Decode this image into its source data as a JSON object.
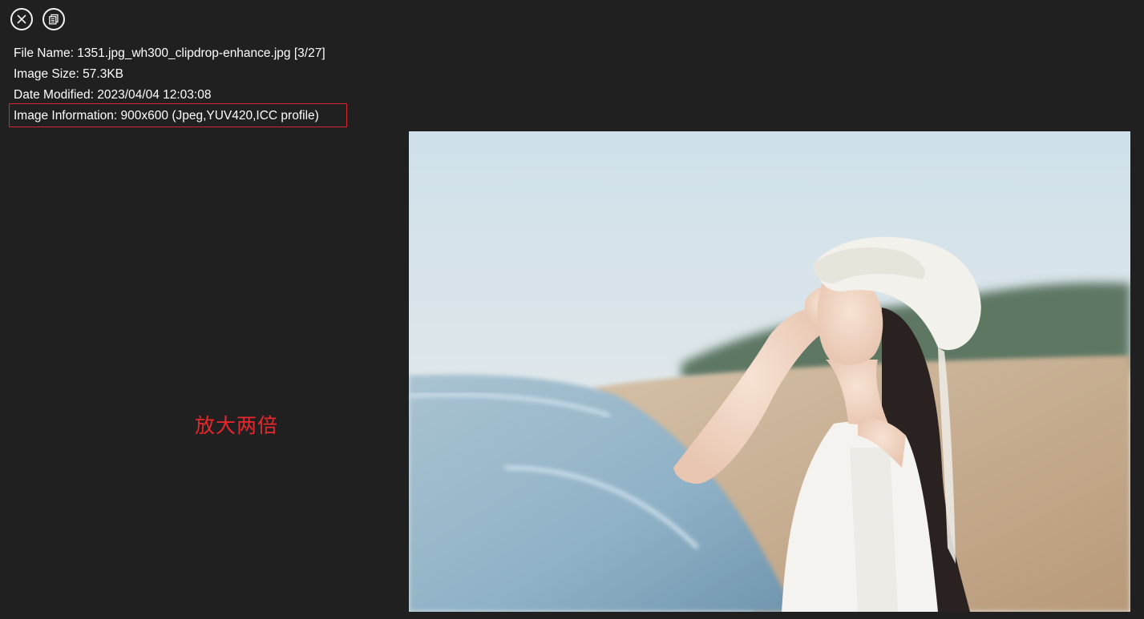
{
  "toolbar": {
    "close_icon": "close-icon",
    "copy_icon": "copy-icon"
  },
  "info": {
    "file_name": "File Name: 1351.jpg_wh300_clipdrop-enhance.jpg [3/27]",
    "image_size": "Image Size: 57.3KB",
    "date_modified": "Date Modified: 2023/04/04 12:03:08",
    "image_information": "Image Information: 900x600 (Jpeg,YUV420,ICC profile)"
  },
  "annotation": {
    "text": "放大两倍",
    "color": "#e8262c"
  },
  "colors": {
    "background": "#202020",
    "highlight_border": "#d4262c",
    "text": "#ffffff"
  }
}
